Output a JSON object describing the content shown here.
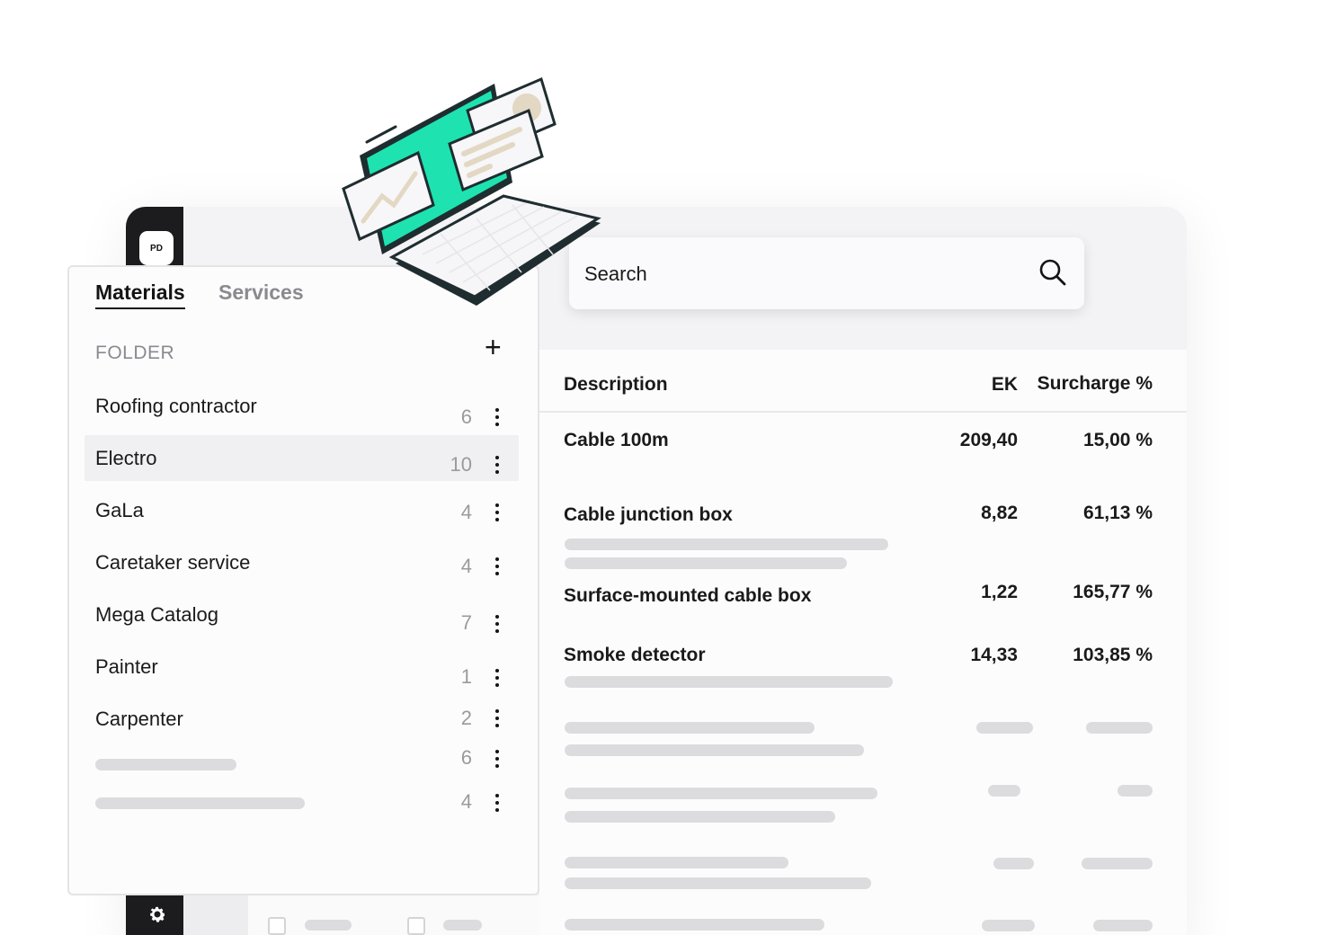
{
  "app": {
    "avatar_initials": "PD",
    "accent_color": "#1ee3b0"
  },
  "left_panel": {
    "tabs": [
      {
        "label": "Materials",
        "active": true
      },
      {
        "label": "Services",
        "active": false
      }
    ],
    "folder_label": "FOLDER",
    "add_label": "+",
    "folders": [
      {
        "label": "Roofing contractor",
        "count": "6"
      },
      {
        "label": "Electro",
        "count": "10",
        "selected": true
      },
      {
        "label": "GaLa",
        "count": "4"
      },
      {
        "label": "Caretaker service",
        "count": "4"
      },
      {
        "label": "Mega Catalog",
        "count": "7"
      },
      {
        "label": "Painter",
        "count": "1"
      },
      {
        "label": "Carpenter",
        "count": "2"
      },
      {
        "label": "",
        "count": "6"
      },
      {
        "label": "",
        "count": "4"
      }
    ]
  },
  "search": {
    "placeholder": "Search",
    "icon": "search-icon"
  },
  "table": {
    "columns": [
      "Description",
      "EK",
      "Surcharge %"
    ],
    "rows": [
      {
        "description": "Cable 100m",
        "ek": "209,40",
        "surcharge": "15,00 %"
      },
      {
        "description": "Cable junction box",
        "ek": "8,82",
        "surcharge": "61,13 %"
      },
      {
        "description": "Surface-mounted cable box",
        "ek": "1,22",
        "surcharge": "165,77 %"
      },
      {
        "description": "Smoke detector",
        "ek": "14,33",
        "surcharge": "103,85 %"
      }
    ]
  }
}
